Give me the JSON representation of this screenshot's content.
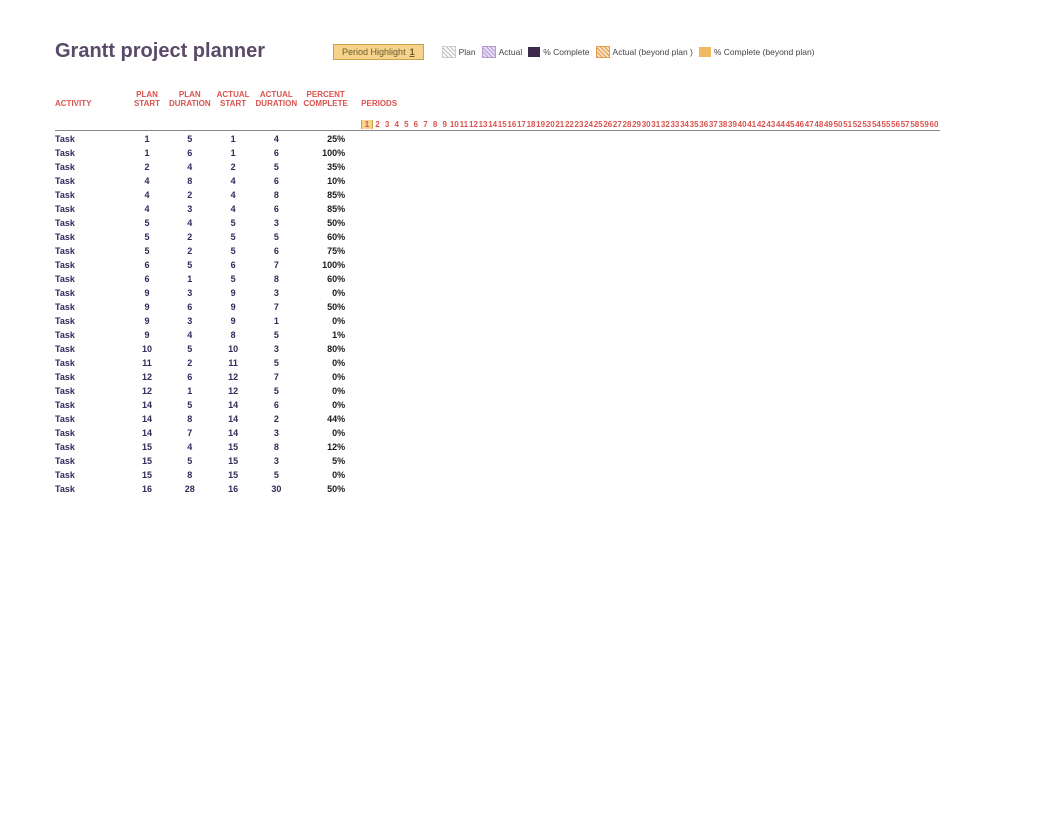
{
  "title": "Grantt project planner",
  "highlight": {
    "label": "Period Highlight",
    "value": "1"
  },
  "legend": {
    "plan": "Plan",
    "actual": "Actual",
    "complete": "% Complete",
    "actual_beyond": "Actual (beyond plan )",
    "complete_beyond": "% Complete (beyond plan)"
  },
  "headers": {
    "activity": "ACTIVITY",
    "plan_start": "PLAN START",
    "plan_duration": "PLAN DURATION",
    "actual_start": "ACTUAL START",
    "actual_duration": "ACTUAL DURATION",
    "percent_complete": "PERCENT COMPLETE",
    "periods": "PERIODS"
  },
  "period_count": 60,
  "highlight_period": 1,
  "rows": [
    {
      "activity": "Task",
      "plan_start": 1,
      "plan_dur": 5,
      "actual_start": 1,
      "actual_dur": 4,
      "pct": "25%"
    },
    {
      "activity": "Task",
      "plan_start": 1,
      "plan_dur": 6,
      "actual_start": 1,
      "actual_dur": 6,
      "pct": "100%"
    },
    {
      "activity": "Task",
      "plan_start": 2,
      "plan_dur": 4,
      "actual_start": 2,
      "actual_dur": 5,
      "pct": "35%"
    },
    {
      "activity": "Task",
      "plan_start": 4,
      "plan_dur": 8,
      "actual_start": 4,
      "actual_dur": 6,
      "pct": "10%"
    },
    {
      "activity": "Task",
      "plan_start": 4,
      "plan_dur": 2,
      "actual_start": 4,
      "actual_dur": 8,
      "pct": "85%"
    },
    {
      "activity": "Task",
      "plan_start": 4,
      "plan_dur": 3,
      "actual_start": 4,
      "actual_dur": 6,
      "pct": "85%"
    },
    {
      "activity": "Task",
      "plan_start": 5,
      "plan_dur": 4,
      "actual_start": 5,
      "actual_dur": 3,
      "pct": "50%"
    },
    {
      "activity": "Task",
      "plan_start": 5,
      "plan_dur": 2,
      "actual_start": 5,
      "actual_dur": 5,
      "pct": "60%"
    },
    {
      "activity": "Task",
      "plan_start": 5,
      "plan_dur": 2,
      "actual_start": 5,
      "actual_dur": 6,
      "pct": "75%"
    },
    {
      "activity": "Task",
      "plan_start": 6,
      "plan_dur": 5,
      "actual_start": 6,
      "actual_dur": 7,
      "pct": "100%"
    },
    {
      "activity": "Task",
      "plan_start": 6,
      "plan_dur": 1,
      "actual_start": 5,
      "actual_dur": 8,
      "pct": "60%"
    },
    {
      "activity": "Task",
      "plan_start": 9,
      "plan_dur": 3,
      "actual_start": 9,
      "actual_dur": 3,
      "pct": "0%"
    },
    {
      "activity": "Task",
      "plan_start": 9,
      "plan_dur": 6,
      "actual_start": 9,
      "actual_dur": 7,
      "pct": "50%"
    },
    {
      "activity": "Task",
      "plan_start": 9,
      "plan_dur": 3,
      "actual_start": 9,
      "actual_dur": 1,
      "pct": "0%"
    },
    {
      "activity": "Task",
      "plan_start": 9,
      "plan_dur": 4,
      "actual_start": 8,
      "actual_dur": 5,
      "pct": "1%"
    },
    {
      "activity": "Task",
      "plan_start": 10,
      "plan_dur": 5,
      "actual_start": 10,
      "actual_dur": 3,
      "pct": "80%"
    },
    {
      "activity": "Task",
      "plan_start": 11,
      "plan_dur": 2,
      "actual_start": 11,
      "actual_dur": 5,
      "pct": "0%"
    },
    {
      "activity": "Task",
      "plan_start": 12,
      "plan_dur": 6,
      "actual_start": 12,
      "actual_dur": 7,
      "pct": "0%"
    },
    {
      "activity": "Task",
      "plan_start": 12,
      "plan_dur": 1,
      "actual_start": 12,
      "actual_dur": 5,
      "pct": "0%"
    },
    {
      "activity": "Task",
      "plan_start": 14,
      "plan_dur": 5,
      "actual_start": 14,
      "actual_dur": 6,
      "pct": "0%"
    },
    {
      "activity": "Task",
      "plan_start": 14,
      "plan_dur": 8,
      "actual_start": 14,
      "actual_dur": 2,
      "pct": "44%"
    },
    {
      "activity": "Task",
      "plan_start": 14,
      "plan_dur": 7,
      "actual_start": 14,
      "actual_dur": 3,
      "pct": "0%"
    },
    {
      "activity": "Task",
      "plan_start": 15,
      "plan_dur": 4,
      "actual_start": 15,
      "actual_dur": 8,
      "pct": "12%"
    },
    {
      "activity": "Task",
      "plan_start": 15,
      "plan_dur": 5,
      "actual_start": 15,
      "actual_dur": 3,
      "pct": "5%"
    },
    {
      "activity": "Task",
      "plan_start": 15,
      "plan_dur": 8,
      "actual_start": 15,
      "actual_dur": 5,
      "pct": "0%"
    },
    {
      "activity": "Task",
      "plan_start": 16,
      "plan_dur": 28,
      "actual_start": 16,
      "actual_dur": 30,
      "pct": "50%"
    }
  ]
}
